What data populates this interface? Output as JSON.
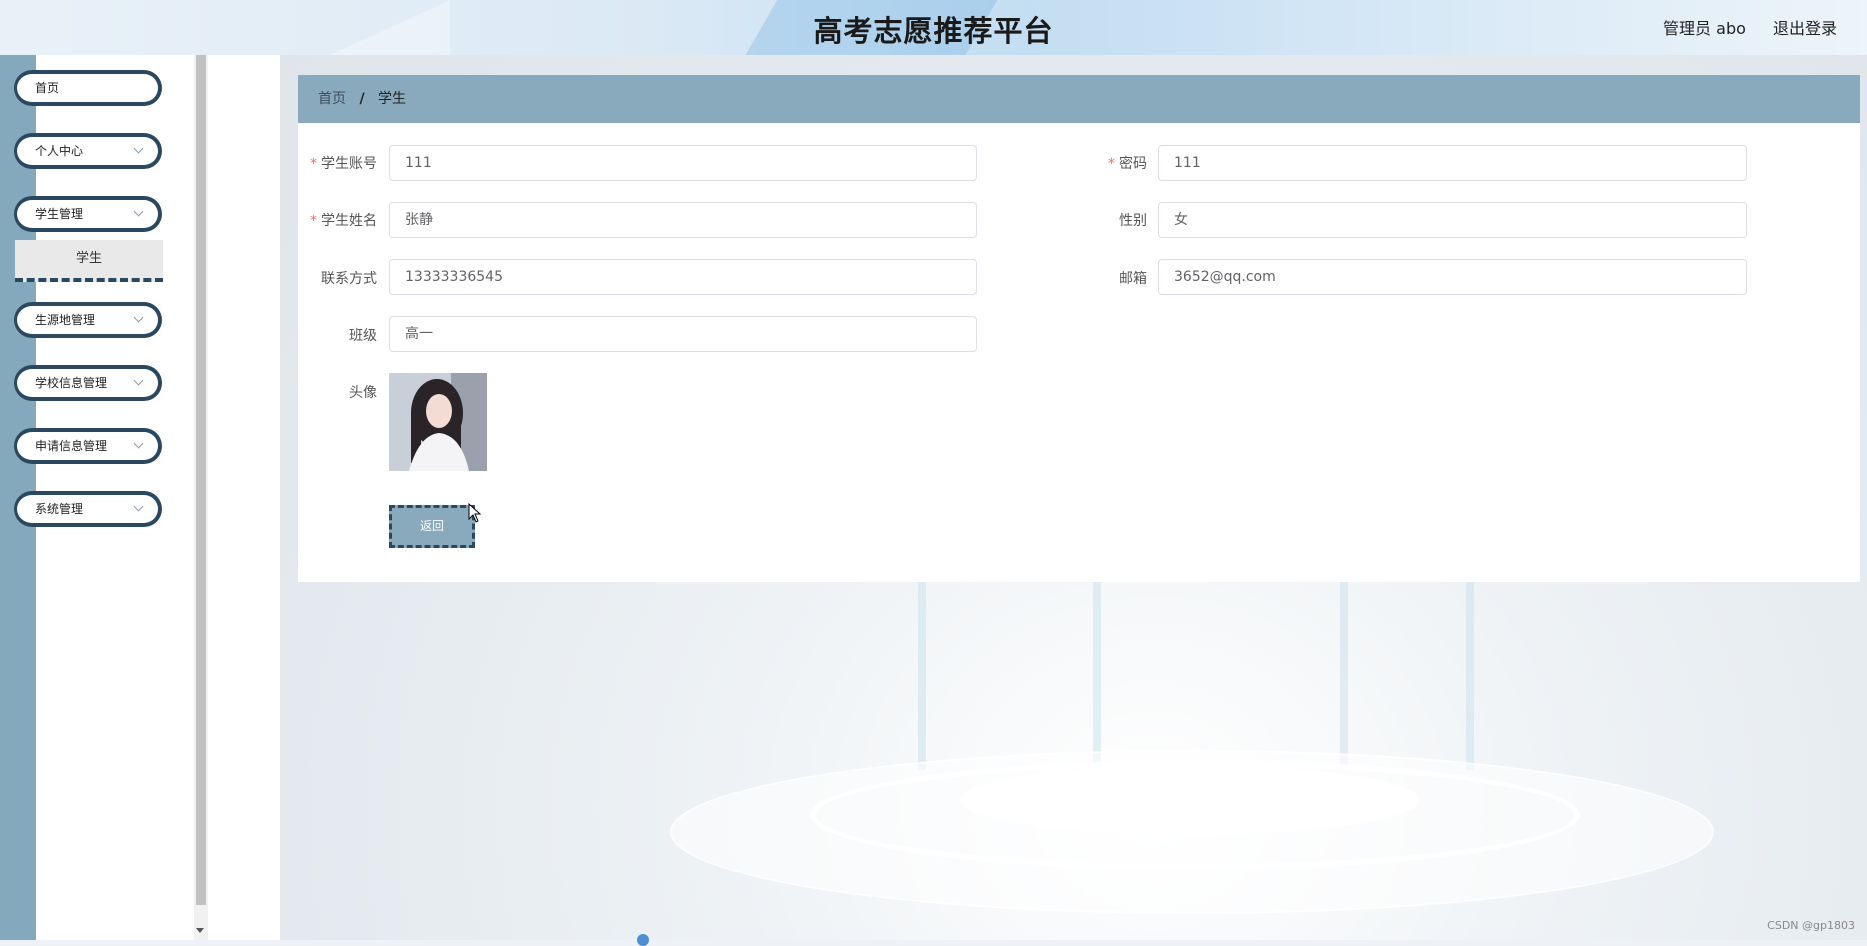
{
  "header": {
    "title": "高考志愿推荐平台",
    "role_user": "管理员 abo",
    "logout": "退出登录"
  },
  "sidebar": {
    "items": [
      {
        "label": "首页"
      },
      {
        "label": "个人中心"
      },
      {
        "label": "学生管理"
      },
      {
        "label": "生源地管理"
      },
      {
        "label": "学校信息管理"
      },
      {
        "label": "申请信息管理"
      },
      {
        "label": "系统管理"
      }
    ],
    "submenu": {
      "label": "学生"
    }
  },
  "breadcrumb": {
    "home": "首页",
    "separator": "/",
    "current": "学生"
  },
  "form": {
    "account": {
      "label": "学生账号",
      "value": "111",
      "required": "*"
    },
    "password": {
      "label": "密码",
      "value": "111",
      "required": "*"
    },
    "name": {
      "label": "学生姓名",
      "value": "张静",
      "required": "*"
    },
    "gender": {
      "label": "性别",
      "value": "女"
    },
    "phone": {
      "label": "联系方式",
      "value": "13333336545"
    },
    "email": {
      "label": "邮箱",
      "value": "3652@qq.com"
    },
    "class": {
      "label": "班级",
      "value": "高一"
    },
    "avatar": {
      "label": "头像"
    },
    "back_button": "返回"
  },
  "watermark": "CSDN @gp1803",
  "colors": {
    "accent": "#89aabc",
    "dark_border": "#2b4861",
    "required": "#f56c6c"
  }
}
